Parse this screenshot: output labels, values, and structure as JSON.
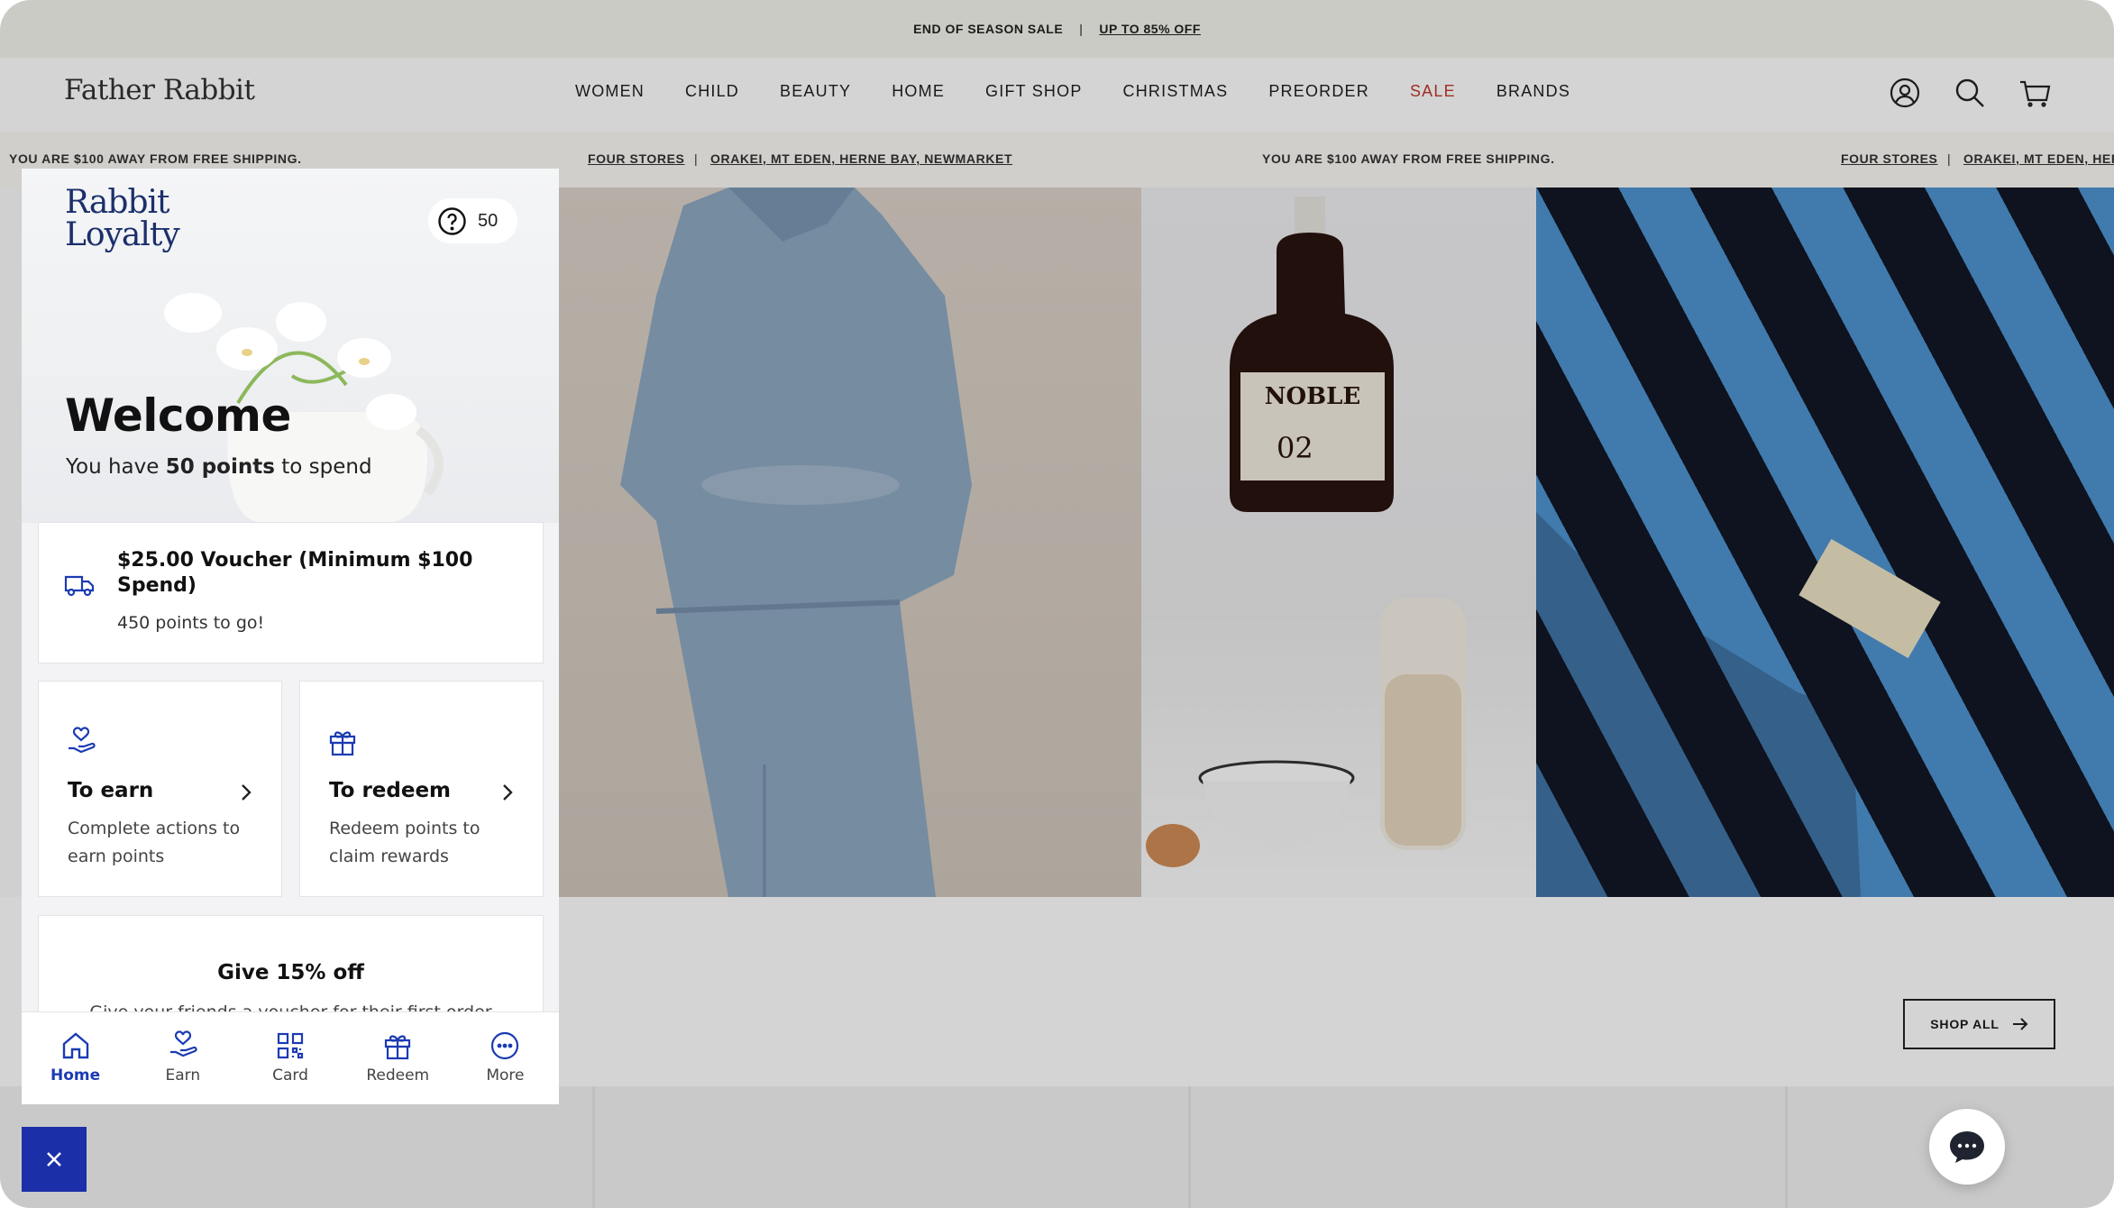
{
  "site": {
    "logo": "Father Rabbit",
    "announcement": {
      "left": "END OF SEASON SALE",
      "separator": "|",
      "right": "UP TO 85% OFF"
    },
    "nav": [
      "WOMEN",
      "CHILD",
      "BEAUTY",
      "HOME",
      "GIFT SHOP",
      "CHRISTMAS",
      "PREORDER",
      "SALE",
      "BRANDS"
    ],
    "sale_color": "#c0392b",
    "header_icons": [
      "account-icon",
      "search-icon",
      "cart-icon"
    ],
    "ticker": {
      "shipping": "YOU ARE $100 AWAY FROM FREE SHIPPING.",
      "stores": "FOUR STORES",
      "separator": "|",
      "locations": "ORAKEI, MT EDEN, HERNE BAY, NEWMARKET",
      "locations_cut": "ORAKEI, MT EDEN, HERI"
    },
    "shop_all": "SHOP ALL"
  },
  "loyalty": {
    "logo_line1": "Rabbit",
    "logo_line2": "Loyalty",
    "logo_color": "#1b2f6b",
    "points_badge": "50",
    "welcome": "Welcome",
    "spend_prefix": "You have ",
    "spend_points": "50 points",
    "spend_suffix": " to spend",
    "voucher": {
      "title": "$25.00 Voucher (Minimum $100 Spend)",
      "subtitle": "450 points to go!"
    },
    "earn": {
      "title": "To earn",
      "desc": "Complete actions to earn points"
    },
    "redeem": {
      "title": "To redeem",
      "desc": "Redeem points to claim rewards"
    },
    "give": {
      "title": "Give 15% off",
      "subtitle": "Give your friends a voucher for their first order"
    },
    "bottom_nav": [
      "Home",
      "Earn",
      "Card",
      "Redeem",
      "More"
    ],
    "accent": "#1b3bb3"
  }
}
